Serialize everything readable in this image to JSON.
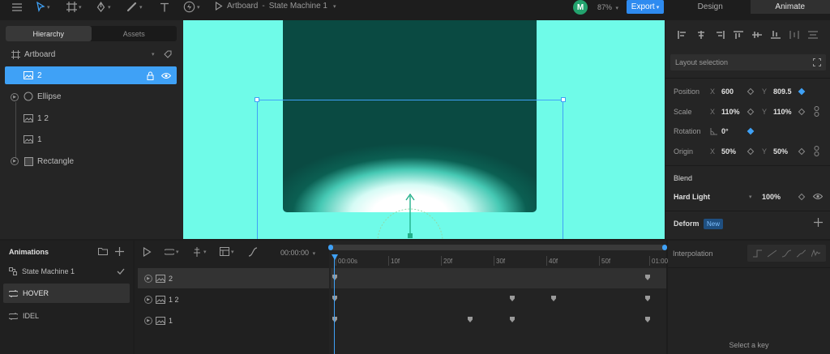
{
  "topbar": {
    "breadcrumb": "Artboard",
    "breadcrumb_sep": "-",
    "state_machine": "State Machine 1",
    "avatar_letter": "M",
    "zoom": "87%",
    "export_label": "Export",
    "mode_tabs": [
      "Design",
      "Animate"
    ],
    "active_mode": "Animate"
  },
  "left": {
    "tabs": [
      "Hierarchy",
      "Assets"
    ],
    "artboard_label": "Artboard",
    "items": [
      {
        "label": "2",
        "icon": "image-icon",
        "selected": true
      },
      {
        "label": "Ellipse",
        "icon": "ellipse-icon"
      },
      {
        "label": "1 2",
        "icon": "image-icon"
      },
      {
        "label": "1",
        "icon": "image-icon"
      },
      {
        "label": "Rectangle",
        "icon": "rectangle-icon"
      }
    ]
  },
  "right": {
    "layout_selection": "Layout selection",
    "position": {
      "label": "Position",
      "x_axis": "X",
      "x": "600",
      "y_axis": "Y",
      "y": "809.5"
    },
    "scale": {
      "label": "Scale",
      "x_axis": "X",
      "x": "110%",
      "y_axis": "Y",
      "y": "110%"
    },
    "rotation": {
      "label": "Rotation",
      "value": "0°"
    },
    "origin": {
      "label": "Origin",
      "x_axis": "X",
      "x": "50%",
      "y_axis": "Y",
      "y": "50%"
    },
    "blend_label": "Blend",
    "blend_mode": "Hard Light",
    "opacity": "100%",
    "deform_label": "Deform",
    "new_badge": "New"
  },
  "animations": {
    "title": "Animations",
    "items": [
      {
        "label": "State Machine 1",
        "kind": "state-machine"
      },
      {
        "label": "HOVER",
        "kind": "loop",
        "active": true
      },
      {
        "label": "IDEL",
        "kind": "loop"
      }
    ]
  },
  "timeline": {
    "time": "00:00:00",
    "ticks": [
      "00:00s",
      "10f",
      "20f",
      "30f",
      "40f",
      "50f",
      "01:00"
    ],
    "rows": [
      "2",
      "1 2",
      "1"
    ]
  },
  "interpolation": {
    "title": "Interpolation",
    "empty_hint": "Select a key"
  },
  "colors": {
    "accent": "#3fa1f6",
    "canvas_bg": "#6ffbe8",
    "export": "#2e8bf0",
    "avatar": "#23a36e"
  }
}
